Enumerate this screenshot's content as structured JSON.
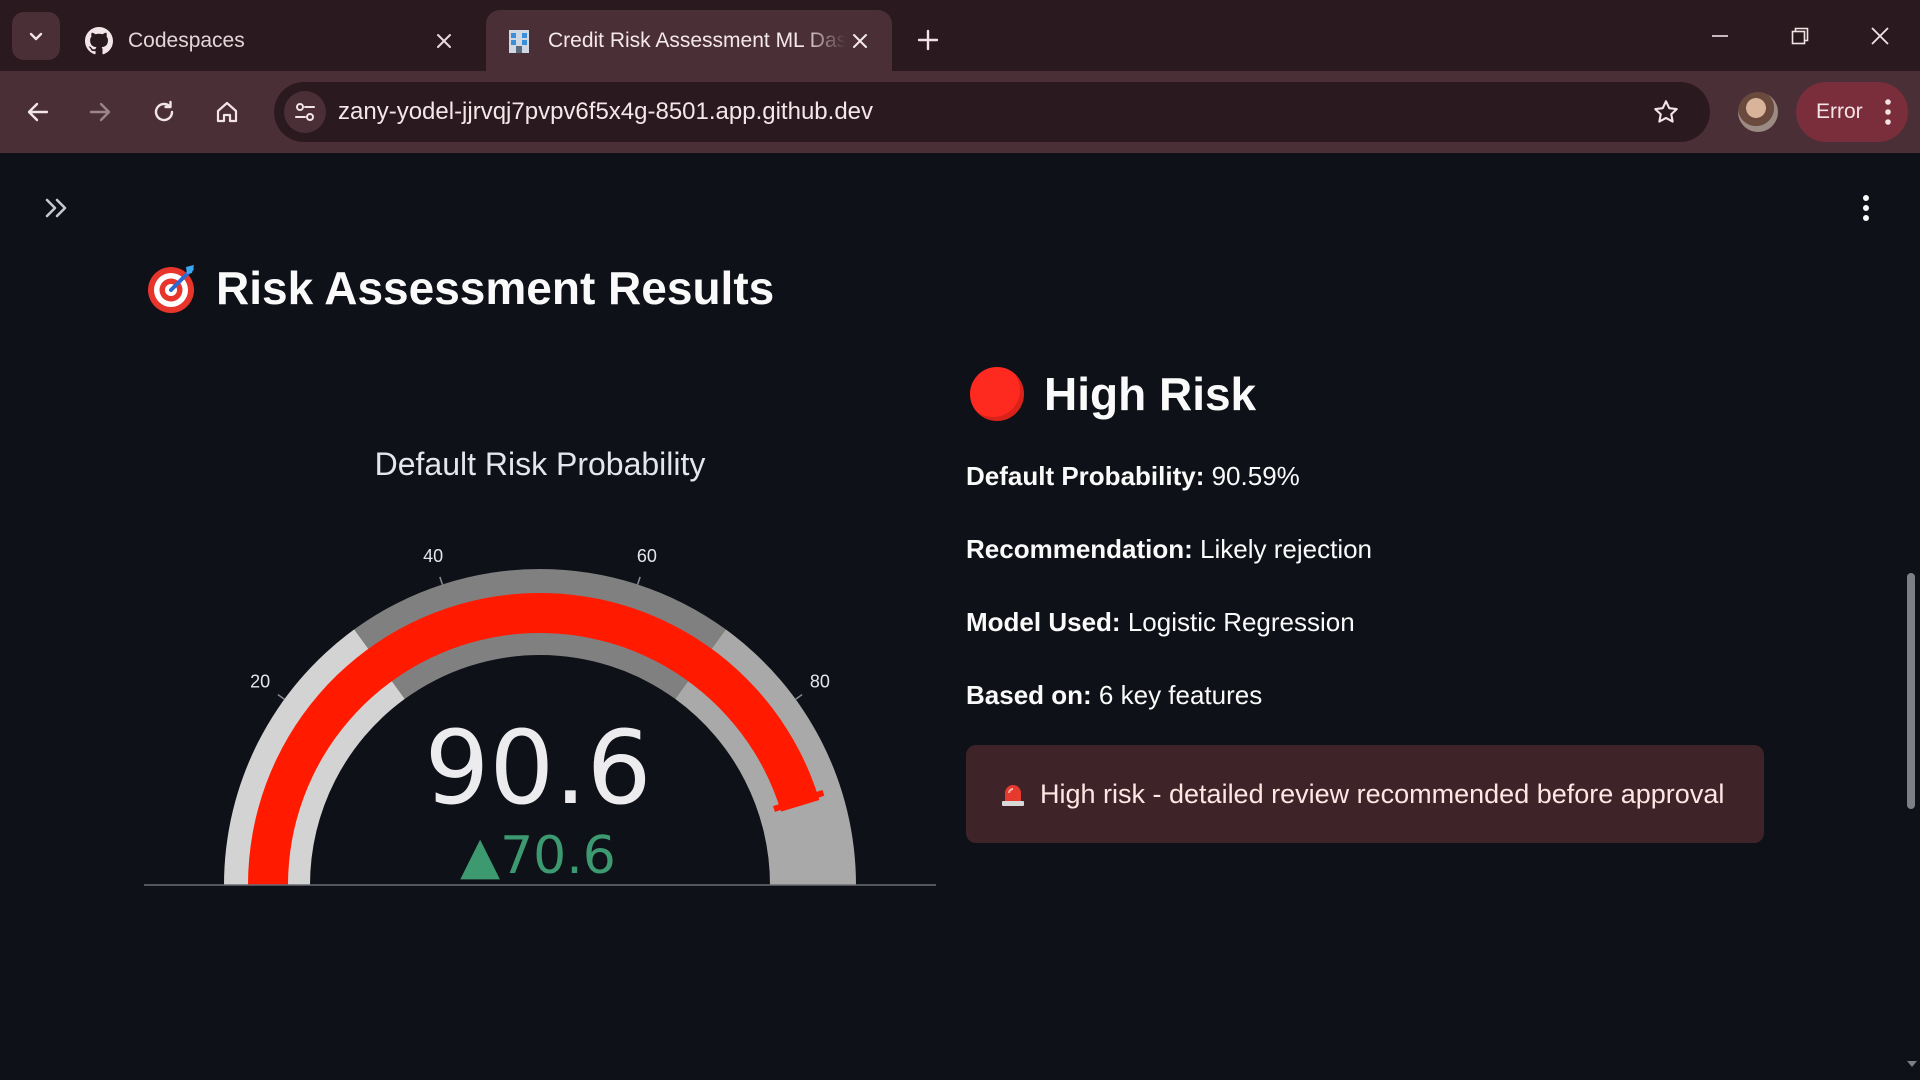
{
  "browser": {
    "tabs": [
      {
        "title": "Codespaces",
        "active": false
      },
      {
        "title": "Credit Risk Assessment ML Dashboard",
        "active": true
      }
    ],
    "url": "zany-yodel-jjrvqj7pvpv6f5x4g-8501.app.github.dev",
    "error_label": "Error"
  },
  "page": {
    "heading": "Risk Assessment Results",
    "heading_icon": "direct-hit-emoji",
    "risk_level": "High Risk",
    "risk_color": "#ff2a1f",
    "details": [
      {
        "label": "Default Probability:",
        "value": "90.59%"
      },
      {
        "label": "Recommendation:",
        "value": "Likely rejection"
      },
      {
        "label": "Model Used:",
        "value": "Logistic Regression"
      },
      {
        "label": "Based on:",
        "value": "6 key features"
      }
    ],
    "alert": "High risk - detailed review recommended before approval",
    "alert_icon": "rotating-light-emoji"
  },
  "chart_data": {
    "type": "gauge",
    "title": "Default Risk Probability",
    "value": 90.6,
    "value_label": "90.6",
    "delta_label": "▲70.6",
    "delta": 70.6,
    "range": [
      0,
      100
    ],
    "tick_labels": [
      "20",
      "40",
      "60",
      "80"
    ],
    "bands": [
      {
        "from": 0,
        "to": 30,
        "color": "#d3d3d3"
      },
      {
        "from": 30,
        "to": 70,
        "color": "#808080"
      },
      {
        "from": 70,
        "to": 100,
        "color": "#a9a9a9"
      }
    ],
    "bar_color": "#ff1a00",
    "threshold": 90,
    "threshold_color": "#ff1a00",
    "delta_color": "#3d9970"
  }
}
